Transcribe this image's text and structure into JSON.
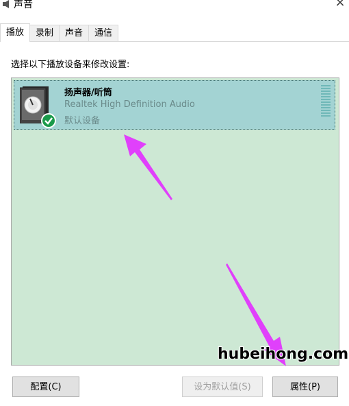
{
  "window": {
    "title": "声音",
    "close_label": "×"
  },
  "tabs": [
    {
      "label": "播放",
      "active": true
    },
    {
      "label": "录制",
      "active": false
    },
    {
      "label": "声音",
      "active": false
    },
    {
      "label": "通信",
      "active": false
    }
  ],
  "panel": {
    "instruction": "选择以下播放设备来修改设置:",
    "devices": [
      {
        "name": "扬声器/听筒",
        "driver": "Realtek High Definition Audio",
        "status": "默认设备",
        "selected": true,
        "icon": "speaker-icon",
        "badge_icon": "check-icon"
      }
    ]
  },
  "buttons": {
    "configure": "配置(C)",
    "set_default": "设为默认值(S)",
    "properties": "属性(P)"
  },
  "watermark": "hubeihong.com",
  "colors": {
    "list_bg": "#cde8d4",
    "selected_bg": "#a3d3d3",
    "annotation_arrow": "#e040fb",
    "check_badge": "#1a9a4a"
  }
}
